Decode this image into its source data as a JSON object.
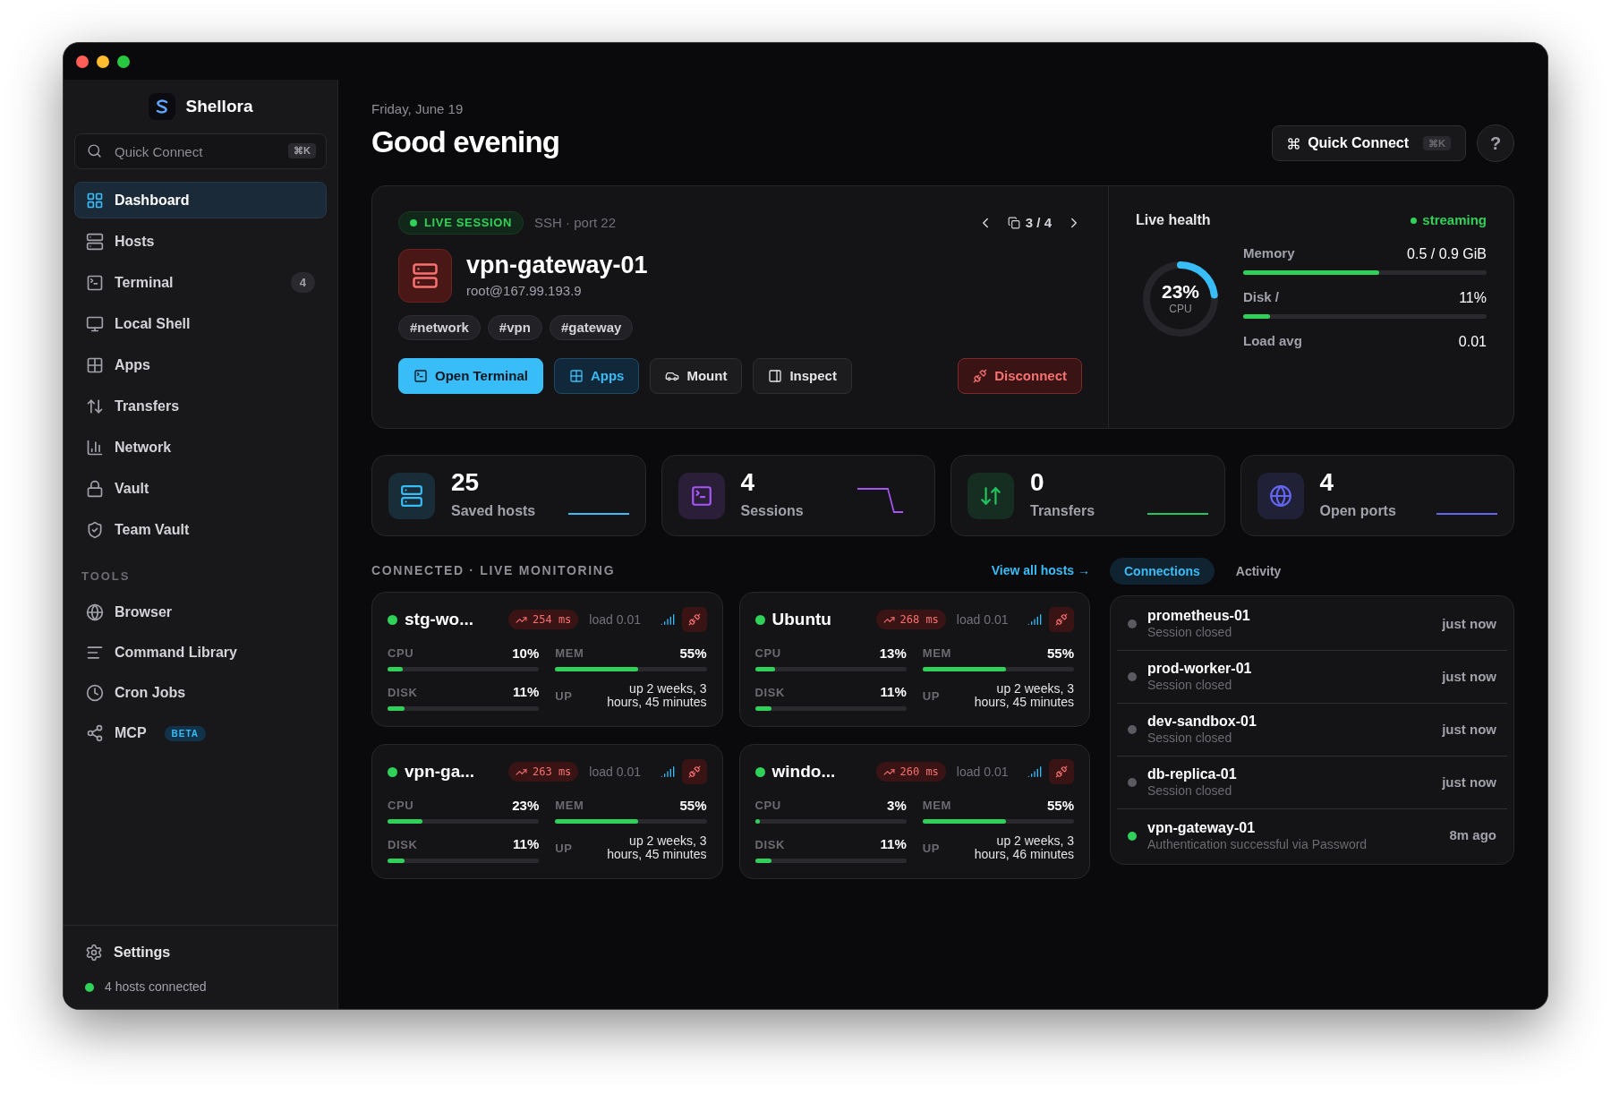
{
  "sidebar": {
    "app_name": "Shellora",
    "search": {
      "placeholder": "Quick Connect",
      "shortcut": "⌘K"
    },
    "items": [
      {
        "label": "Dashboard",
        "selected": true
      },
      {
        "label": "Hosts",
        "selected": false
      },
      {
        "label": "Terminal",
        "selected": false,
        "badge": "4"
      },
      {
        "label": "Local Shell",
        "selected": false
      },
      {
        "label": "Apps",
        "selected": false
      },
      {
        "label": "Transfers",
        "selected": false
      },
      {
        "label": "Network",
        "selected": false
      },
      {
        "label": "Vault",
        "selected": false
      },
      {
        "label": "Team Vault",
        "selected": false
      }
    ],
    "tools_heading": "TOOLS",
    "tools": [
      {
        "label": "Browser",
        "selected": false
      },
      {
        "label": "Command Library",
        "selected": false
      },
      {
        "label": "Cron Jobs",
        "selected": false
      },
      {
        "label": "MCP",
        "selected": false,
        "badge": "BETA"
      }
    ],
    "settings": "Settings",
    "status": "4 hosts connected"
  },
  "header": {
    "date": "Friday, June 19",
    "greeting": "Good evening",
    "quick_connect": "Quick Connect",
    "shortcut": "⌘K",
    "help": "?"
  },
  "session": {
    "badge": "LIVE SESSION",
    "meta": "SSH · port 22",
    "pager": "3 / 4",
    "host": "vpn-gateway-01",
    "address": "root@167.99.193.9",
    "tags": [
      "#network",
      "#vpn",
      "#gateway"
    ],
    "actions": [
      {
        "label": "Open Terminal",
        "kind": "primary"
      },
      {
        "label": "Apps",
        "kind": "accent"
      },
      {
        "label": "Mount",
        "kind": "plain"
      },
      {
        "label": "Inspect",
        "kind": "plain"
      },
      {
        "label": "Disconnect",
        "kind": "danger"
      }
    ],
    "health": {
      "title": "Live health",
      "status": "streaming",
      "cpu": {
        "value": "23%",
        "label": "CPU",
        "level": 0.23
      },
      "metrics": [
        {
          "label": "Memory",
          "value": "0.5 / 0.9 GiB",
          "level": 0.56
        },
        {
          "label": "Disk /",
          "value": "11%",
          "level": 0.11
        },
        {
          "label": "Load avg",
          "value": "0.01"
        }
      ]
    }
  },
  "stats": [
    {
      "value": "25",
      "label": "Saved hosts",
      "color": "#38bdf8"
    },
    {
      "value": "4",
      "label": "Sessions",
      "color": "#a855f7"
    },
    {
      "value": "0",
      "label": "Transfers",
      "color": "#22c55e"
    },
    {
      "value": "4",
      "label": "Open ports",
      "color": "#6366f1"
    }
  ],
  "monitoring": {
    "title": "CONNECTED · LIVE MONITORING",
    "link": "View all hosts →",
    "hosts": [
      {
        "name": "stg-wo...",
        "online": true,
        "latency": "254 ms",
        "load": "load 0.01",
        "metrics": [
          {
            "label": "CPU",
            "value": "10%",
            "level": 0.1
          },
          {
            "label": "MEM",
            "value": "55%",
            "level": 0.55
          },
          {
            "label": "DISK",
            "value": "11%",
            "level": 0.11
          }
        ],
        "uptime_label": "UP",
        "uptime": "up 2 weeks, 3 hours, 45 minutes"
      },
      {
        "name": "Ubuntu",
        "online": true,
        "latency": "268 ms",
        "load": "load 0.01",
        "metrics": [
          {
            "label": "CPU",
            "value": "13%",
            "level": 0.13
          },
          {
            "label": "MEM",
            "value": "55%",
            "level": 0.55
          },
          {
            "label": "DISK",
            "value": "11%",
            "level": 0.11
          }
        ],
        "uptime_label": "UP",
        "uptime": "up 2 weeks, 3 hours, 45 minutes"
      },
      {
        "name": "vpn-ga...",
        "online": true,
        "latency": "263 ms",
        "load": "load 0.01",
        "metrics": [
          {
            "label": "CPU",
            "value": "23%",
            "level": 0.23
          },
          {
            "label": "MEM",
            "value": "55%",
            "level": 0.55
          },
          {
            "label": "DISK",
            "value": "11%",
            "level": 0.11
          }
        ],
        "uptime_label": "UP",
        "uptime": "up 2 weeks, 3 hours, 45 minutes"
      },
      {
        "name": "windo...",
        "online": true,
        "latency": "260 ms",
        "load": "load 0.01",
        "metrics": [
          {
            "label": "CPU",
            "value": "3%",
            "level": 0.03
          },
          {
            "label": "MEM",
            "value": "55%",
            "level": 0.55
          },
          {
            "label": "DISK",
            "value": "11%",
            "level": 0.11
          }
        ],
        "uptime_label": "UP",
        "uptime": "up 2 weeks, 3 hours, 46 minutes"
      }
    ]
  },
  "tabs": [
    {
      "label": "Connections",
      "selected": true
    },
    {
      "label": "Activity",
      "selected": false
    }
  ],
  "connections": [
    {
      "name": "prometheus-01",
      "detail": "Session closed",
      "time": "just now",
      "active": false
    },
    {
      "name": "prod-worker-01",
      "detail": "Session closed",
      "time": "just now",
      "active": false
    },
    {
      "name": "dev-sandbox-01",
      "detail": "Session closed",
      "time": "just now",
      "active": false
    },
    {
      "name": "db-replica-01",
      "detail": "Session closed",
      "time": "just now",
      "active": false
    },
    {
      "name": "vpn-gateway-01",
      "detail": "Authentication successful via Password",
      "time": "8m ago",
      "active": true
    }
  ]
}
